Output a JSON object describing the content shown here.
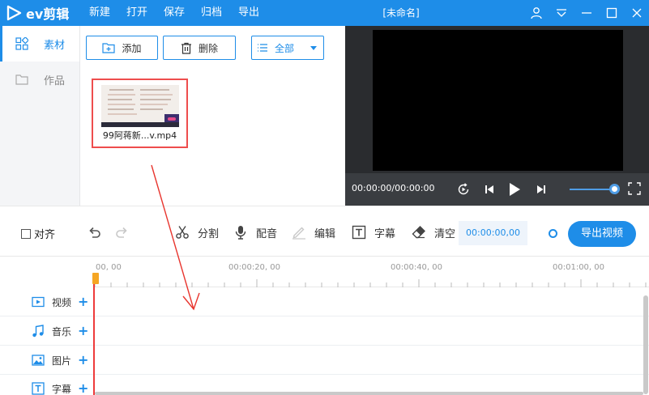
{
  "app": {
    "logo_text": "ev剪辑",
    "window_title": "[未命名]",
    "accent": "#1e8de8"
  },
  "menu": [
    {
      "label": "新建"
    },
    {
      "label": "打开"
    },
    {
      "label": "保存"
    },
    {
      "label": "归档"
    },
    {
      "label": "导出"
    }
  ],
  "window_controls": [
    "user-icon",
    "dropdown-icon",
    "minimize-icon",
    "maximize-icon",
    "close-icon"
  ],
  "leftnav": {
    "items": [
      {
        "label": "素材",
        "icon": "grid-icon",
        "active": true
      },
      {
        "label": "作品",
        "icon": "folder-icon",
        "active": false
      }
    ]
  },
  "material": {
    "add_label": "添加",
    "delete_label": "删除",
    "filter_label": "全部",
    "clip": {
      "name": "99阿蒋新...v.mp4"
    }
  },
  "preview": {
    "timecode": "00:00:00/00:00:00",
    "volume": 1.0
  },
  "edit_toolbar": {
    "align_label": "对齐",
    "split_label": "分割",
    "dub_label": "配音",
    "edit_label": "编辑",
    "subtitle_label": "字幕",
    "clear_label": "清空",
    "current_time": "00:00:00,00",
    "export_label": "导出视频"
  },
  "timeline": {
    "ruler_labels": [
      "00, 00",
      "00:00:20, 00",
      "00:00:40, 00",
      "00:01:00, 00"
    ],
    "tracks": [
      {
        "label": "视频",
        "icon": "video-icon"
      },
      {
        "label": "音乐",
        "icon": "music-icon"
      },
      {
        "label": "图片",
        "icon": "image-icon"
      },
      {
        "label": "字幕",
        "icon": "subtitle-icon"
      }
    ]
  }
}
